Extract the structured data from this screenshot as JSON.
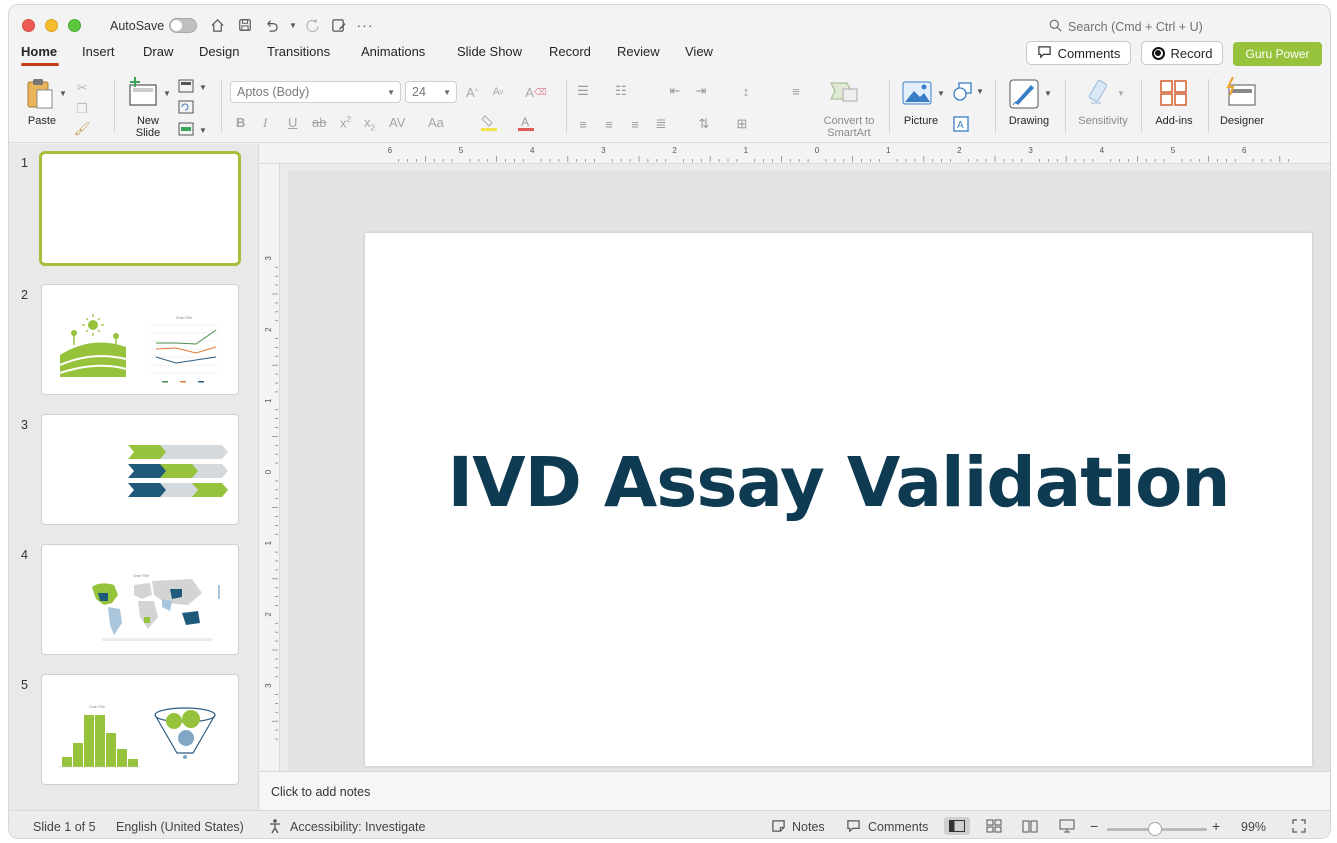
{
  "titlebar": {
    "autosave_label": "AutoSave",
    "search_placeholder": "Search (Cmd + Ctrl + U)"
  },
  "tabs": [
    {
      "label": "Home"
    },
    {
      "label": "Insert"
    },
    {
      "label": "Draw"
    },
    {
      "label": "Design"
    },
    {
      "label": "Transitions"
    },
    {
      "label": "Animations"
    },
    {
      "label": "Slide Show"
    },
    {
      "label": "Record"
    },
    {
      "label": "Review"
    },
    {
      "label": "View"
    }
  ],
  "actions": {
    "comments": "Comments",
    "record": "Record",
    "guru": "Guru Power"
  },
  "ribbon": {
    "paste": "Paste",
    "new_slide_1": "New",
    "new_slide_2": "Slide",
    "font_name": "Aptos (Body)",
    "font_size": "24",
    "convert_1": "Convert to",
    "convert_2": "SmartArt",
    "picture": "Picture",
    "drawing": "Drawing",
    "sensitivity": "Sensitivity",
    "addins": "Add-ins",
    "designer": "Designer"
  },
  "slides": [
    {
      "number": "1"
    },
    {
      "number": "2",
      "chart_title": "Chart Title"
    },
    {
      "number": "3"
    },
    {
      "number": "4",
      "chart_title": "Chart Title"
    },
    {
      "number": "5",
      "chart_title": "Chart Title"
    }
  ],
  "slide": {
    "title": "IVD Assay Validation"
  },
  "notes_placeholder": "Click to add notes",
  "status": {
    "slide_count": "Slide 1 of 5",
    "language": "English (United States)",
    "accessibility": "Accessibility: Investigate",
    "notes": "Notes",
    "comments": "Comments",
    "zoom": "99%"
  },
  "colors": {
    "accent_green": "#96c23c",
    "title_navy": "#0e3a52",
    "tab_underline": "#c43e1c"
  }
}
